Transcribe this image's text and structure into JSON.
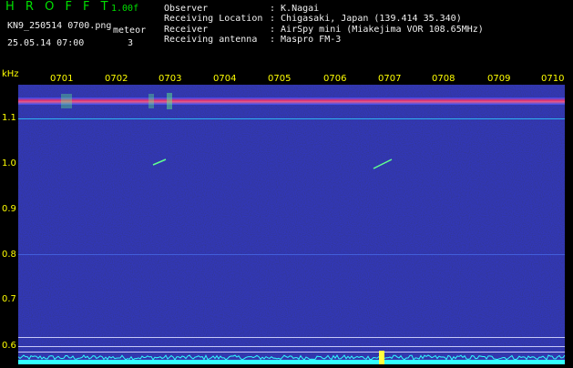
{
  "header": {
    "brand": "H R O F F T",
    "version": "1.00f",
    "filename": "KN9_250514 0700.png",
    "mode_label": "meteor",
    "datetime": "25.05.14 07:00",
    "count": "3",
    "fields": [
      {
        "label": "Observer",
        "value": ": K.Nagai"
      },
      {
        "label": "Receiving Location",
        "value": ": Chigasaki, Japan (139.414 35.340)"
      },
      {
        "label": "Receiver",
        "value": ": AirSpy mini (Miakejima VOR 108.65MHz)"
      },
      {
        "label": "Receiving antenna",
        "value": ": Maspro FM-3"
      }
    ]
  },
  "axis": {
    "y_unit": "kHz",
    "y_ticks": [
      "1.1",
      "1.0",
      "0.9",
      "0.8",
      "0.7",
      "0.6"
    ],
    "x_ticks": [
      "0701",
      "0702",
      "0703",
      "0704",
      "0705",
      "0706",
      "0707",
      "0708",
      "0709",
      "0710"
    ]
  },
  "colors": {
    "background": "#101480",
    "carrier": "#ff3060",
    "trace": "#30ffff",
    "label_yellow": "#ffff00",
    "label_green": "#00e000"
  }
}
